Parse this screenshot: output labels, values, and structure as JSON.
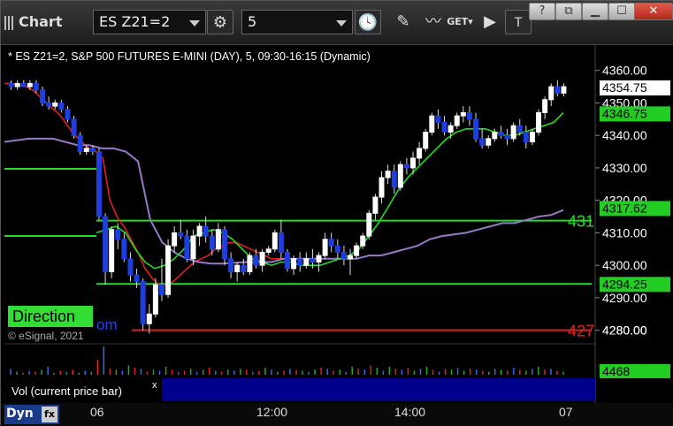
{
  "toolbar": {
    "app_title": "Chart",
    "symbol": "ES Z21=2",
    "interval": "5",
    "window_buttons": [
      "?",
      "⧉",
      "☐",
      "✕"
    ]
  },
  "chart_header": "* ES Z21=2, S&P 500 FUTURES E-MINI (DAY), 5, 09:30-16:15 (Dynamic)",
  "copyright": "© eSignal, 2021",
  "direction_label": "Direction",
  "partial_label": "om",
  "vol_panel_label": "Vol (current price bar)",
  "vol_close": "x",
  "dyn_label": "Dyn",
  "fx_label": "fx",
  "chart_data": {
    "type": "candlestick",
    "title": "* ES Z21=2, S&P 500 FUTURES E-MINI (DAY), 5, 09:30-16:15 (Dynamic)",
    "price_axis": {
      "ticks": [
        "4360.00",
        "4350.00",
        "4340.00",
        "4330.00",
        "4320.00",
        "4310.00",
        "4300.00",
        "4290.00",
        "4280.00"
      ],
      "ylim": [
        4278,
        4364
      ]
    },
    "time_axis": {
      "ticks": [
        "06",
        "12:00",
        "14:00",
        "07"
      ]
    },
    "price_labels": [
      {
        "value": 4354.75,
        "text": "4354.75",
        "color": "#ffffff",
        "text_color": "#000000"
      },
      {
        "value": 4346.75,
        "text": "4346.75",
        "color": "#22cc22",
        "text_color": "#000000"
      },
      {
        "value": 4317.62,
        "text": "4317.62",
        "color": "#22cc22",
        "text_color": "#000000"
      },
      {
        "value": 4294.25,
        "text": "4294.25",
        "color": "#22cc22",
        "text_color": "#000000"
      },
      {
        "value": 4280.0,
        "text": "4280.00",
        "color": "#000000",
        "text_color": "#ffffff"
      }
    ],
    "horizontal_lines": [
      {
        "value": 4313.75,
        "color": "#22dd22",
        "edge_label": "431",
        "label_color": "#22dd22"
      },
      {
        "value": 4294.25,
        "color": "#22dd22"
      },
      {
        "value": 4280.0,
        "color": "#dd2222",
        "edge_label": "427",
        "label_color": "#dd2222"
      }
    ],
    "series": [
      {
        "name": "price",
        "ohlc": [
          [
            4356,
            4357,
            4354,
            4355
          ],
          [
            4355,
            4357,
            4354,
            4356
          ],
          [
            4356,
            4357,
            4355,
            4355
          ],
          [
            4355,
            4357,
            4354,
            4356
          ],
          [
            4356,
            4357,
            4353,
            4354
          ],
          [
            4354,
            4355,
            4349,
            4350
          ],
          [
            4350,
            4352,
            4348,
            4349
          ],
          [
            4349,
            4351,
            4348,
            4350
          ],
          [
            4350,
            4351,
            4347,
            4348
          ],
          [
            4348,
            4349,
            4344,
            4345
          ],
          [
            4345,
            4346,
            4339,
            4340
          ],
          [
            4340,
            4341,
            4334,
            4335
          ],
          [
            4335,
            4337,
            4334,
            4336
          ],
          [
            4336,
            4337,
            4334,
            4335
          ],
          [
            4335,
            4336,
            4314,
            4315
          ],
          [
            4315,
            4316,
            4294,
            4298
          ],
          [
            4298,
            4312,
            4296,
            4311
          ],
          [
            4311,
            4313,
            4305,
            4308
          ],
          [
            4308,
            4310,
            4301,
            4302
          ],
          [
            4302,
            4304,
            4295,
            4297
          ],
          [
            4297,
            4299,
            4293,
            4295
          ],
          [
            4295,
            4296,
            4280,
            4282
          ],
          [
            4282,
            4288,
            4279,
            4285
          ],
          [
            4285,
            4296,
            4284,
            4294
          ],
          [
            4294,
            4302,
            4289,
            4291
          ],
          [
            4291,
            4308,
            4290,
            4306
          ],
          [
            4306,
            4312,
            4304,
            4310
          ],
          [
            4310,
            4314,
            4308,
            4309
          ],
          [
            4309,
            4311,
            4301,
            4302
          ],
          [
            4302,
            4311,
            4300,
            4309
          ],
          [
            4309,
            4313,
            4306,
            4312
          ],
          [
            4312,
            4315,
            4307,
            4309
          ],
          [
            4309,
            4311,
            4303,
            4305
          ],
          [
            4305,
            4313,
            4304,
            4311
          ],
          [
            4311,
            4312,
            4300,
            4302
          ],
          [
            4302,
            4304,
            4296,
            4298
          ],
          [
            4298,
            4301,
            4295,
            4300
          ],
          [
            4300,
            4302,
            4297,
            4298
          ],
          [
            4298,
            4304,
            4297,
            4303
          ],
          [
            4303,
            4305,
            4299,
            4300
          ],
          [
            4300,
            4305,
            4298,
            4304
          ],
          [
            4304,
            4306,
            4303,
            4305
          ],
          [
            4305,
            4311,
            4304,
            4310
          ],
          [
            4310,
            4314,
            4302,
            4304
          ],
          [
            4304,
            4305,
            4298,
            4299
          ],
          [
            4299,
            4303,
            4297,
            4302
          ],
          [
            4302,
            4304,
            4298,
            4300
          ],
          [
            4300,
            4304,
            4299,
            4302
          ],
          [
            4302,
            4305,
            4299,
            4301
          ],
          [
            4301,
            4304,
            4298,
            4303
          ],
          [
            4303,
            4310,
            4302,
            4308
          ],
          [
            4308,
            4310,
            4304,
            4306
          ],
          [
            4306,
            4308,
            4302,
            4304
          ],
          [
            4304,
            4306,
            4300,
            4302
          ],
          [
            4302,
            4305,
            4297,
            4303
          ],
          [
            4303,
            4307,
            4302,
            4306
          ],
          [
            4306,
            4310,
            4305,
            4309
          ],
          [
            4309,
            4317,
            4308,
            4316
          ],
          [
            4316,
            4322,
            4314,
            4321
          ],
          [
            4321,
            4329,
            4319,
            4327
          ],
          [
            4327,
            4331,
            4325,
            4329
          ],
          [
            4329,
            4331,
            4322,
            4324
          ],
          [
            4324,
            4332,
            4323,
            4331
          ],
          [
            4331,
            4333,
            4328,
            4330
          ],
          [
            4330,
            4335,
            4328,
            4333
          ],
          [
            4333,
            4338,
            4331,
            4336
          ],
          [
            4336,
            4342,
            4335,
            4341
          ],
          [
            4341,
            4347,
            4340,
            4346
          ],
          [
            4346,
            4348,
            4342,
            4344
          ],
          [
            4344,
            4346,
            4340,
            4341
          ],
          [
            4341,
            4344,
            4339,
            4343
          ],
          [
            4343,
            4347,
            4342,
            4346
          ],
          [
            4346,
            4349,
            4344,
            4347
          ],
          [
            4347,
            4349,
            4343,
            4345
          ],
          [
            4345,
            4347,
            4338,
            4339
          ],
          [
            4339,
            4342,
            4336,
            4337
          ],
          [
            4337,
            4340,
            4336,
            4339
          ],
          [
            4339,
            4342,
            4338,
            4341
          ],
          [
            4341,
            4343,
            4339,
            4340
          ],
          [
            4340,
            4342,
            4337,
            4339
          ],
          [
            4339,
            4344,
            4338,
            4343
          ],
          [
            4343,
            4345,
            4340,
            4341
          ],
          [
            4341,
            4343,
            4336,
            4338
          ],
          [
            4338,
            4342,
            4337,
            4341
          ],
          [
            4341,
            4348,
            4340,
            4347
          ],
          [
            4347,
            4352,
            4345,
            4351
          ],
          [
            4351,
            4356,
            4349,
            4355
          ],
          [
            4355,
            4357,
            4352,
            4353
          ],
          [
            4353,
            4356,
            4352,
            4355
          ]
        ]
      },
      {
        "name": "ma-red",
        "color": "#e02020",
        "values": [
          4356,
          4356,
          4355.5,
          4355,
          4354,
          4352,
          4350,
          4348,
          4346,
          4343,
          4340,
          4338,
          4336,
          4335,
          4333,
          4320,
          4315,
          4312,
          4308,
          4304,
          4299,
          4296,
          4294,
          4294,
          4295,
          4297,
          4299,
          4301,
          4302,
          4303,
          4305,
          4306,
          4307,
          4307,
          4306,
          4305,
          4304,
          4303,
          4302,
          4302,
          4302,
          4302
        ]
      },
      {
        "name": "ma-purple",
        "color": "#9a78c8",
        "values": [
          4338,
          4338.5,
          4339,
          4339,
          4339,
          4338,
          4337,
          4337,
          4336,
          4336,
          4335,
          4332,
          4314,
          4307,
          4304,
          4302,
          4301,
          4300.5,
          4300.5,
          4300.8,
          4301,
          4301,
          4301,
          4302,
          4302,
          4302,
          4302,
          4302,
          4302,
          4302,
          4303,
          4303,
          4304,
          4305,
          4306,
          4308,
          4309,
          4309.5,
          4310,
          4311,
          4312,
          4313,
          4313,
          4314,
          4315,
          4315.5,
          4317
        ]
      },
      {
        "name": "ma-green",
        "color": "#22dd22",
        "values": [
          4310,
          4311,
          4312,
          4310,
          4305,
          4301,
          4299,
          4300,
          4302,
          4305,
          4309,
          4310,
          4311,
          4310,
          4308,
          4305,
          4302,
          4301,
          4300,
          4301,
          4301,
          4300,
          4300,
          4300,
          4301,
          4302,
          4303,
          4305,
          4309,
          4313,
          4318,
          4323,
          4327,
          4330,
          4333,
          4336,
          4339,
          4341,
          4342,
          4342,
          4342,
          4341,
          4340,
          4340,
          4341,
          4342,
          4343,
          4344,
          4347
        ]
      }
    ],
    "volume": {
      "last_value": "4468",
      "values": [
        6,
        3,
        2,
        4,
        3,
        5,
        8,
        2,
        4,
        3,
        5,
        2,
        4,
        3,
        15,
        28,
        6,
        5,
        4,
        9,
        7,
        6,
        3,
        5,
        4,
        8,
        5,
        3,
        4,
        6,
        3,
        5,
        7,
        4,
        3,
        5,
        4,
        6,
        5,
        3,
        4,
        7,
        5,
        3,
        4,
        6,
        5,
        4,
        3,
        5,
        7,
        6,
        4,
        5,
        3,
        8,
        6,
        5,
        9,
        7,
        4,
        8,
        6,
        5,
        7,
        4,
        6,
        8,
        5,
        3,
        6,
        5,
        7,
        4,
        6,
        5,
        4,
        3,
        6,
        5,
        4,
        7,
        5,
        4,
        6,
        8,
        5,
        6,
        4,
        3
      ]
    }
  }
}
